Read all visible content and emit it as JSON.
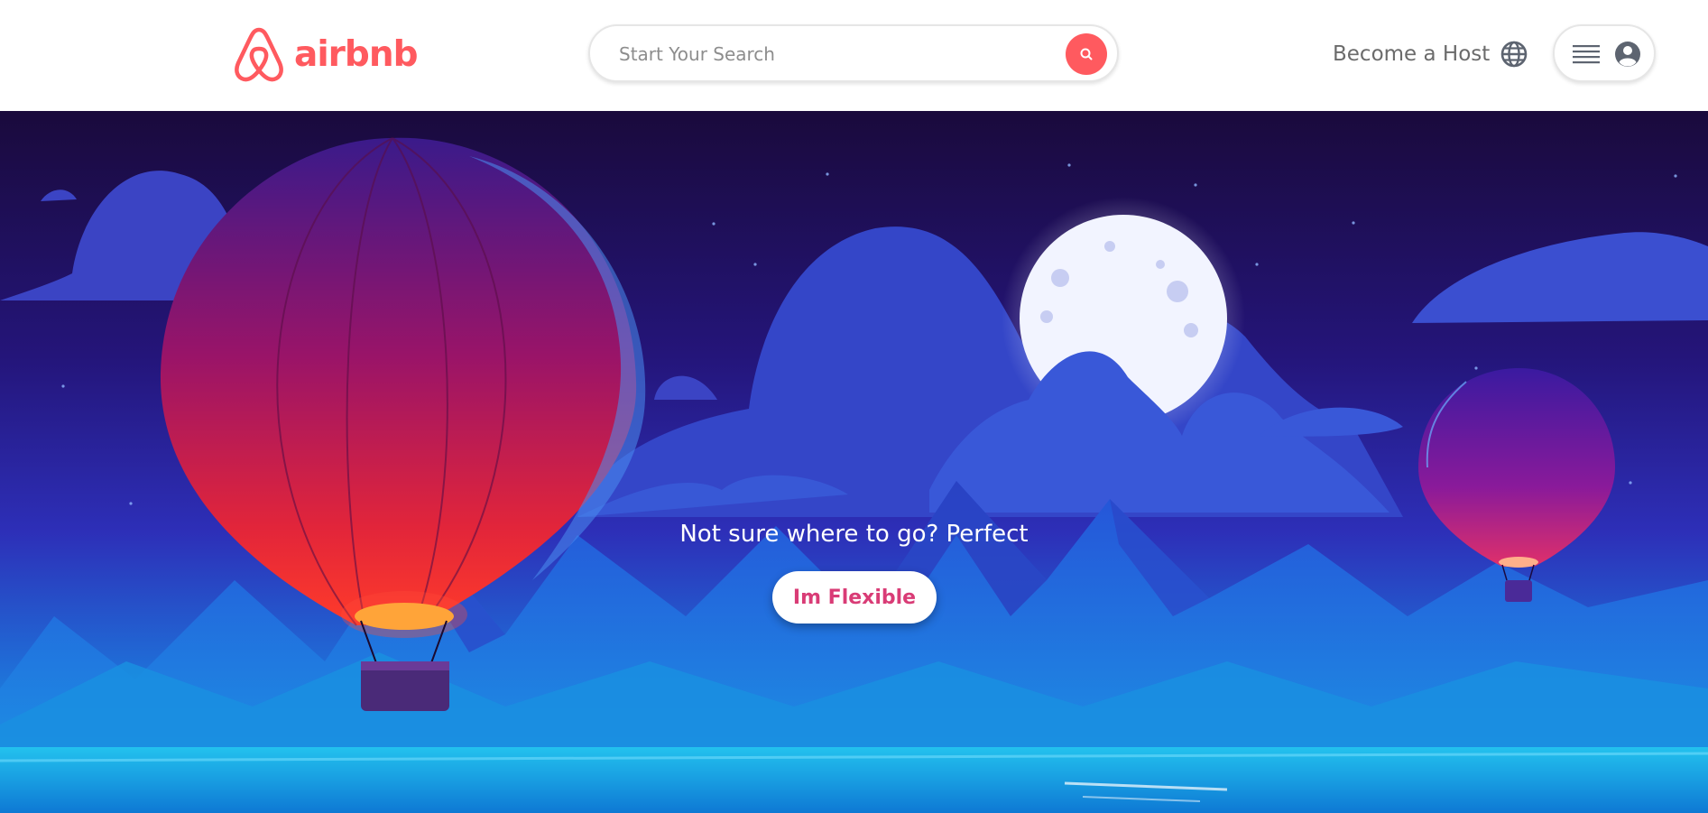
{
  "brand": {
    "name": "airbnb",
    "color": "#ff5a5f"
  },
  "header": {
    "search": {
      "placeholder": "Start Your Search",
      "icon": "search-icon"
    },
    "host_label": "Become a Host",
    "globe_icon": "globe-icon",
    "menu_icon": "hamburger-menu-icon",
    "avatar_icon": "user-avatar-icon"
  },
  "hero": {
    "tagline": "Not sure where to go? Perfect",
    "cta_label": "Im Flexible",
    "cta_color": "#d93c76"
  }
}
